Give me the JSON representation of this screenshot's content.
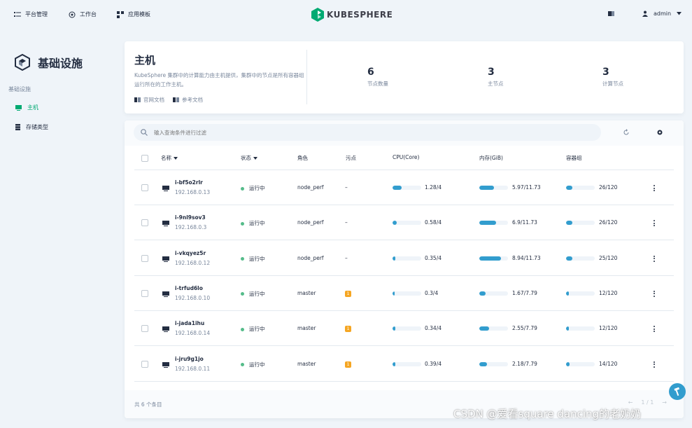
{
  "topnav": {
    "items": [
      {
        "label": "平台管理",
        "icon": "platform-menu-icon"
      },
      {
        "label": "工作台",
        "icon": "workbench-icon"
      },
      {
        "label": "应用模板",
        "icon": "app-template-icon"
      }
    ],
    "brand": "KUBESPHERE",
    "user": "admin"
  },
  "sidebar": {
    "title": "基础设施",
    "group_label": "基础设施",
    "items": [
      {
        "label": "主机",
        "icon": "host-icon",
        "active": true
      },
      {
        "label": "存储类型",
        "icon": "storage-icon",
        "active": false
      }
    ]
  },
  "header": {
    "title": "主机",
    "description": "KubeSphere 集群中的计算能力由主机提供，集群中的节点是所有容器组运行所在的工作主机。",
    "links": [
      "官网文档",
      "参考文档"
    ],
    "stats": [
      {
        "value": "6",
        "label": "节点数量"
      },
      {
        "value": "3",
        "label": "主节点"
      },
      {
        "value": "3",
        "label": "计算节点"
      }
    ]
  },
  "search": {
    "placeholder": "输入查询条件进行过滤"
  },
  "table": {
    "columns": [
      "名称",
      "状态",
      "角色",
      "污点",
      "CPU(Core)",
      "内存(GiB)",
      "容器组"
    ],
    "rows": [
      {
        "name": "i-bf5o2rlr",
        "ip": "192.168.0.13",
        "status": "运行中",
        "role": "node_perf",
        "taint": "–",
        "cpu": "1.28/4",
        "cpu_frac": 0.32,
        "mem": "5.97/11.73",
        "mem_frac": 0.51,
        "pods": "26/120",
        "pods_frac": 0.22
      },
      {
        "name": "i-9nl9sov3",
        "ip": "192.168.0.3",
        "status": "运行中",
        "role": "node_perf",
        "taint": "–",
        "cpu": "0.58/4",
        "cpu_frac": 0.145,
        "mem": "6.9/11.73",
        "mem_frac": 0.59,
        "pods": "26/120",
        "pods_frac": 0.22
      },
      {
        "name": "i-vkqyez5r",
        "ip": "192.168.0.12",
        "status": "运行中",
        "role": "node_perf",
        "taint": "–",
        "cpu": "0.35/4",
        "cpu_frac": 0.09,
        "mem": "8.94/11.73",
        "mem_frac": 0.76,
        "pods": "25/120",
        "pods_frac": 0.21
      },
      {
        "name": "i-trfud6lo",
        "ip": "192.168.0.10",
        "status": "运行中",
        "role": "master",
        "taint": "1",
        "cpu": "0.3/4",
        "cpu_frac": 0.075,
        "mem": "1.67/7.79",
        "mem_frac": 0.21,
        "pods": "12/120",
        "pods_frac": 0.1
      },
      {
        "name": "i-jada1ihu",
        "ip": "192.168.0.14",
        "status": "运行中",
        "role": "master",
        "taint": "1",
        "cpu": "0.34/4",
        "cpu_frac": 0.085,
        "mem": "2.55/7.79",
        "mem_frac": 0.33,
        "pods": "12/120",
        "pods_frac": 0.1
      },
      {
        "name": "i-jru9g1jo",
        "ip": "192.168.0.11",
        "status": "运行中",
        "role": "master",
        "taint": "1",
        "cpu": "0.39/4",
        "cpu_frac": 0.1,
        "mem": "2.18/7.79",
        "mem_frac": 0.28,
        "pods": "14/120",
        "pods_frac": 0.12
      }
    ]
  },
  "footer": {
    "total": "共 6 个条目",
    "page": "1 / 1"
  },
  "watermark": "CSDN @爱看square dancing的老奶奶",
  "colors": {
    "accent": "#00aa72",
    "bar": "#329dce",
    "status_ok": "#55bc8a",
    "taint": "#f5a623"
  }
}
